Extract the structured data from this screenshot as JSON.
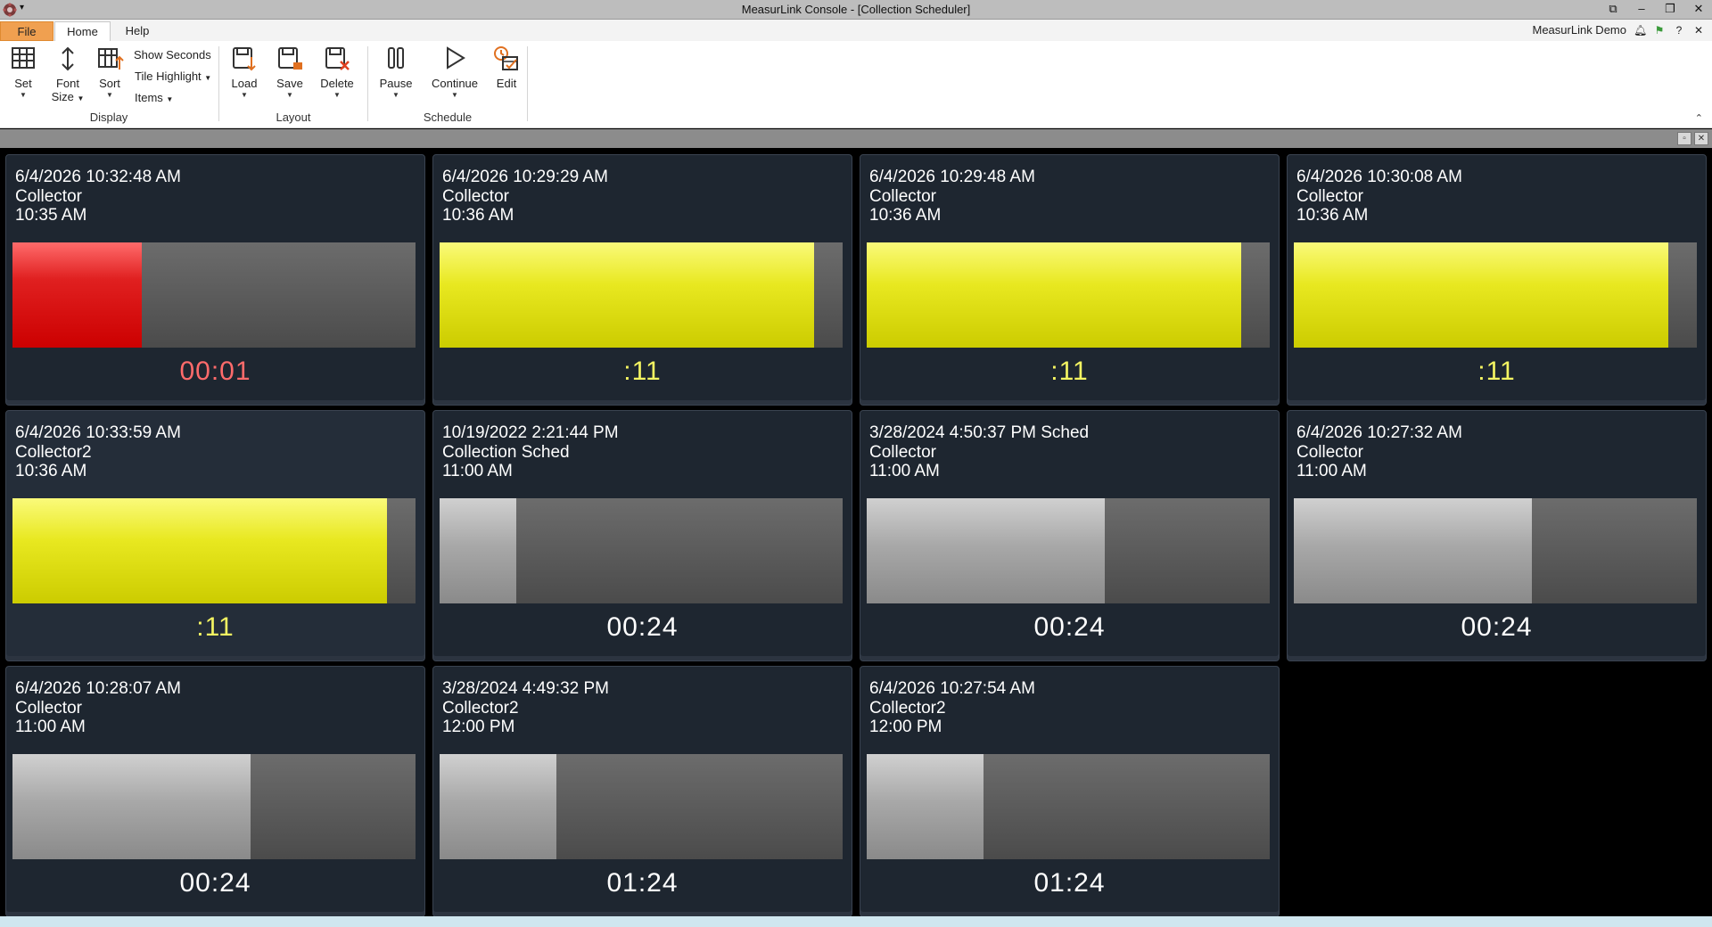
{
  "window": {
    "title": "MeasurLink Console - [Collection Scheduler]",
    "qa_glyph": "▾"
  },
  "tabs": [
    {
      "label": "File"
    },
    {
      "label": "Home"
    },
    {
      "label": "Help"
    }
  ],
  "account": {
    "name": "MeasurLink Demo"
  },
  "ribbon": {
    "display": {
      "set_label": "Set",
      "font_label": "Font",
      "size_label": "Size",
      "sort_label": "Sort",
      "show_seconds": "Show Seconds",
      "tile_highlight": "Tile Highlight",
      "items": "Items",
      "group": "Display"
    },
    "layout": {
      "load": "Load",
      "save": "Save",
      "delete": "Delete",
      "group": "Layout"
    },
    "schedule": {
      "pause": "Pause",
      "continue": "Continue",
      "edit": "Edit",
      "group": "Schedule"
    }
  },
  "colors": {
    "red": "#cc0000",
    "yellow": "#e8e820",
    "gray": "#a8a8a8",
    "file_tab": "#f0a050"
  },
  "tiles": [
    {
      "timestamp": "6/4/2026 10:32:48 AM",
      "collector": "Collector",
      "time": "10:35 AM",
      "progress": 0.32,
      "status": "red",
      "timer": "00:01"
    },
    {
      "timestamp": "6/4/2026 10:29:29 AM",
      "collector": "Collector",
      "time": "10:36 AM",
      "progress": 0.93,
      "status": "yellow",
      "timer": ":11"
    },
    {
      "timestamp": "6/4/2026 10:29:48 AM",
      "collector": "Collector",
      "time": "10:36 AM",
      "progress": 0.93,
      "status": "yellow",
      "timer": ":11"
    },
    {
      "timestamp": "6/4/2026 10:30:08 AM",
      "collector": "Collector",
      "time": "10:36 AM",
      "progress": 0.93,
      "status": "yellow",
      "timer": ":11"
    },
    {
      "timestamp": "6/4/2026 10:33:59 AM",
      "collector": "Collector2",
      "time": "10:36 AM",
      "progress": 0.93,
      "status": "yellow",
      "timer": ":11",
      "highlighted": true
    },
    {
      "timestamp": "10/19/2022 2:21:44 PM",
      "collector": "Collection Sched",
      "time": "11:00 AM",
      "progress": 0.19,
      "status": "gray",
      "timer": "00:24"
    },
    {
      "timestamp": "3/28/2024 4:50:37 PM Sched",
      "collector": "Collector",
      "time": "11:00 AM",
      "progress": 0.59,
      "status": "gray",
      "timer": "00:24"
    },
    {
      "timestamp": "6/4/2026 10:27:32 AM",
      "collector": "Collector",
      "time": "11:00 AM",
      "progress": 0.59,
      "status": "gray",
      "timer": "00:24"
    },
    {
      "timestamp": "6/4/2026 10:28:07 AM",
      "collector": "Collector",
      "time": "11:00 AM",
      "progress": 0.59,
      "status": "gray",
      "timer": "00:24"
    },
    {
      "timestamp": "3/28/2024 4:49:32 PM",
      "collector": "Collector2",
      "time": "12:00 PM",
      "progress": 0.29,
      "status": "gray",
      "timer": "01:24"
    },
    {
      "timestamp": "6/4/2026 10:27:54 AM",
      "collector": "Collector2",
      "time": "12:00 PM",
      "progress": 0.29,
      "status": "gray",
      "timer": "01:24"
    }
  ]
}
